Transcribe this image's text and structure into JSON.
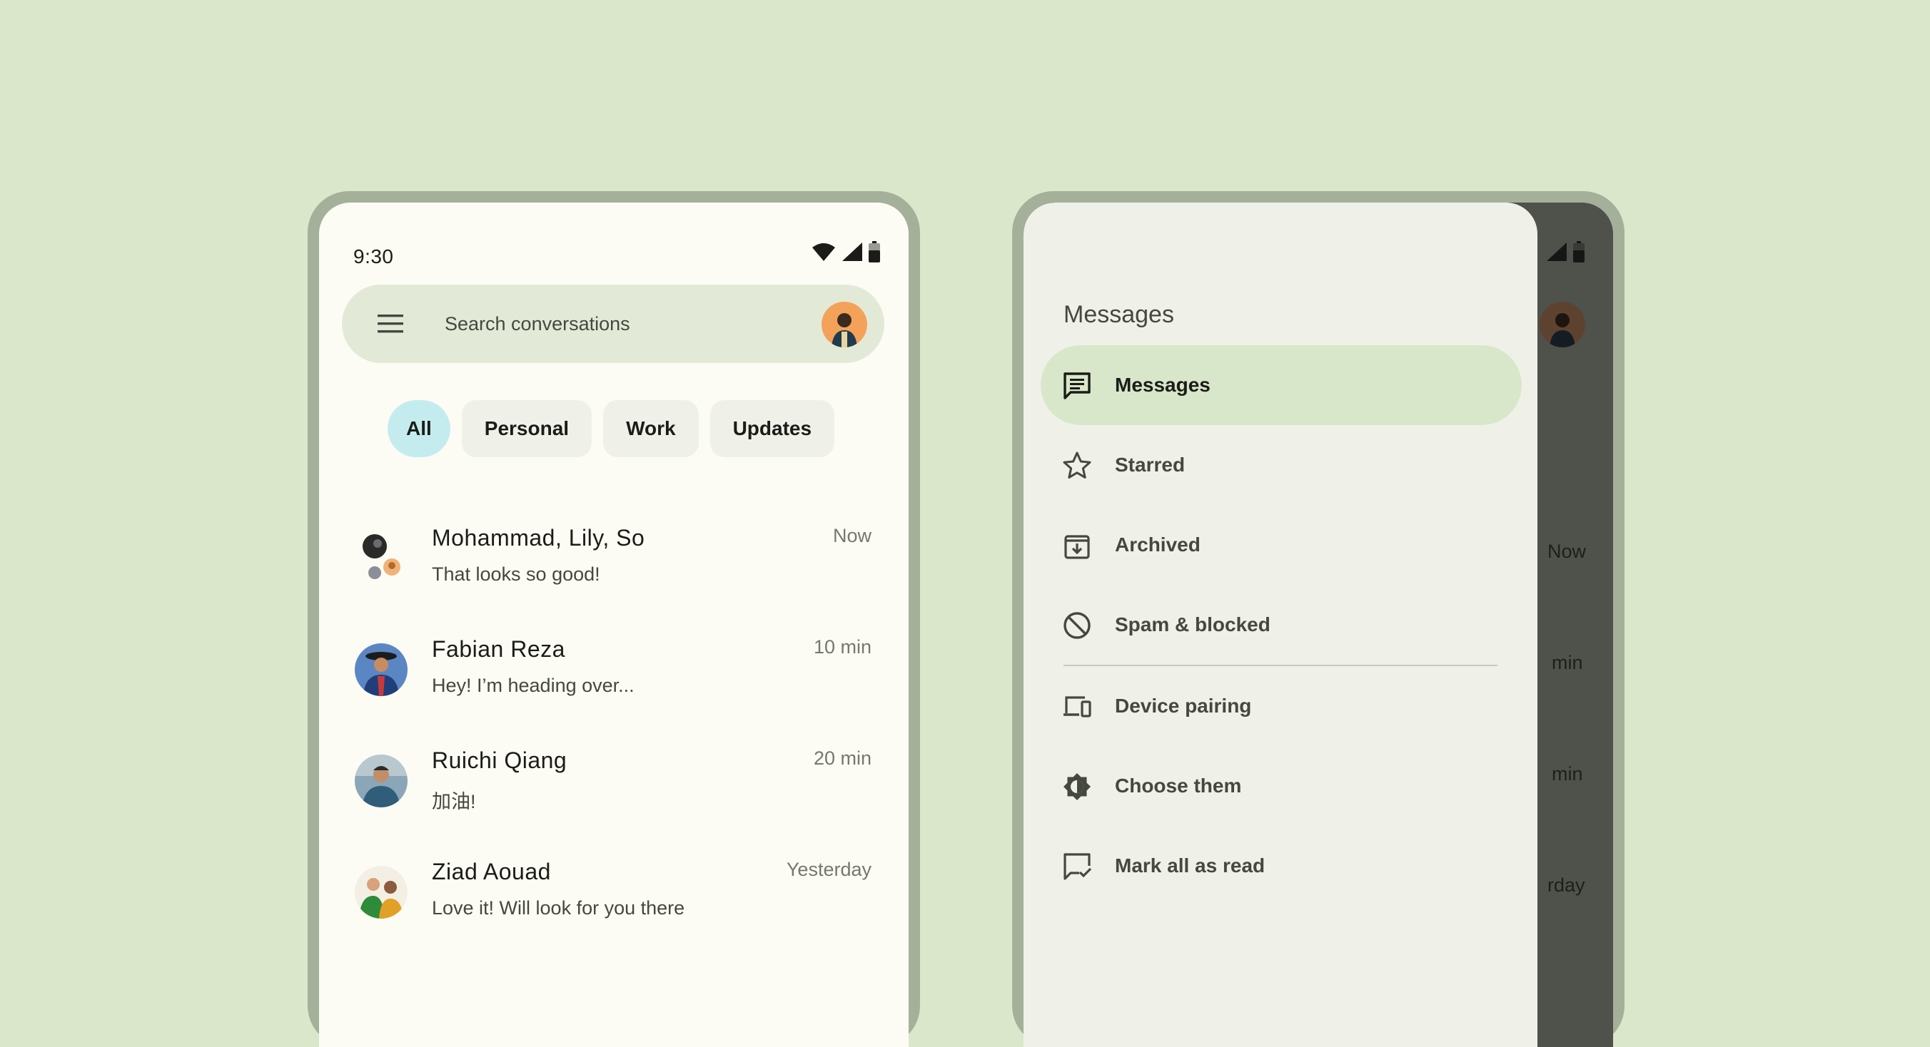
{
  "colors": {
    "background": "#dbe7ca",
    "phone_frame": "#a5b09a",
    "surface": "#fcfcf4",
    "search_bar": "#e2ead7",
    "chip": "#eff1e8",
    "chip_selected": "#c4ecef",
    "drawer": "#eff1e8",
    "drawer_active": "#d8e7c9",
    "scrim": "#4f514b"
  },
  "status_bar": {
    "time": "9:30",
    "icons": [
      "wifi-icon",
      "cell-signal-icon",
      "battery-icon"
    ]
  },
  "search": {
    "placeholder": "Search conversations",
    "menu_icon": "hamburger-menu-icon"
  },
  "filters": [
    {
      "label": "All",
      "selected": true
    },
    {
      "label": "Personal",
      "selected": false
    },
    {
      "label": "Work",
      "selected": false
    },
    {
      "label": "Updates",
      "selected": false
    }
  ],
  "conversations": [
    {
      "name": "Mohammad, Lily, So",
      "preview": "That looks so good!",
      "time": "Now"
    },
    {
      "name": "Fabian Reza",
      "preview": "Hey! I’m heading over...",
      "time": "10 min"
    },
    {
      "name": "Ruichi Qiang",
      "preview": "加油!",
      "time": "20 min"
    },
    {
      "name": "Ziad Aouad",
      "preview": "Love it! Will look for you there",
      "time": "Yesterday"
    }
  ],
  "background_times": {
    "now_partial": "Now",
    "min_partial_1": "min",
    "min_partial_2": "min",
    "rday_partial": "rday"
  },
  "drawer": {
    "title": "Messages",
    "items": [
      {
        "label": "Messages",
        "icon": "chat-icon",
        "active": true
      },
      {
        "label": "Starred",
        "icon": "star-icon",
        "active": false
      },
      {
        "label": "Archived",
        "icon": "archive-icon",
        "active": false
      },
      {
        "label": "Spam & blocked",
        "icon": "block-icon",
        "active": false
      },
      {
        "label": "Device pairing",
        "icon": "devices-icon",
        "active": false
      },
      {
        "label": "Choose them",
        "icon": "brightness-icon",
        "active": false
      },
      {
        "label": "Mark all as read",
        "icon": "mark-read-icon",
        "active": false
      }
    ]
  }
}
